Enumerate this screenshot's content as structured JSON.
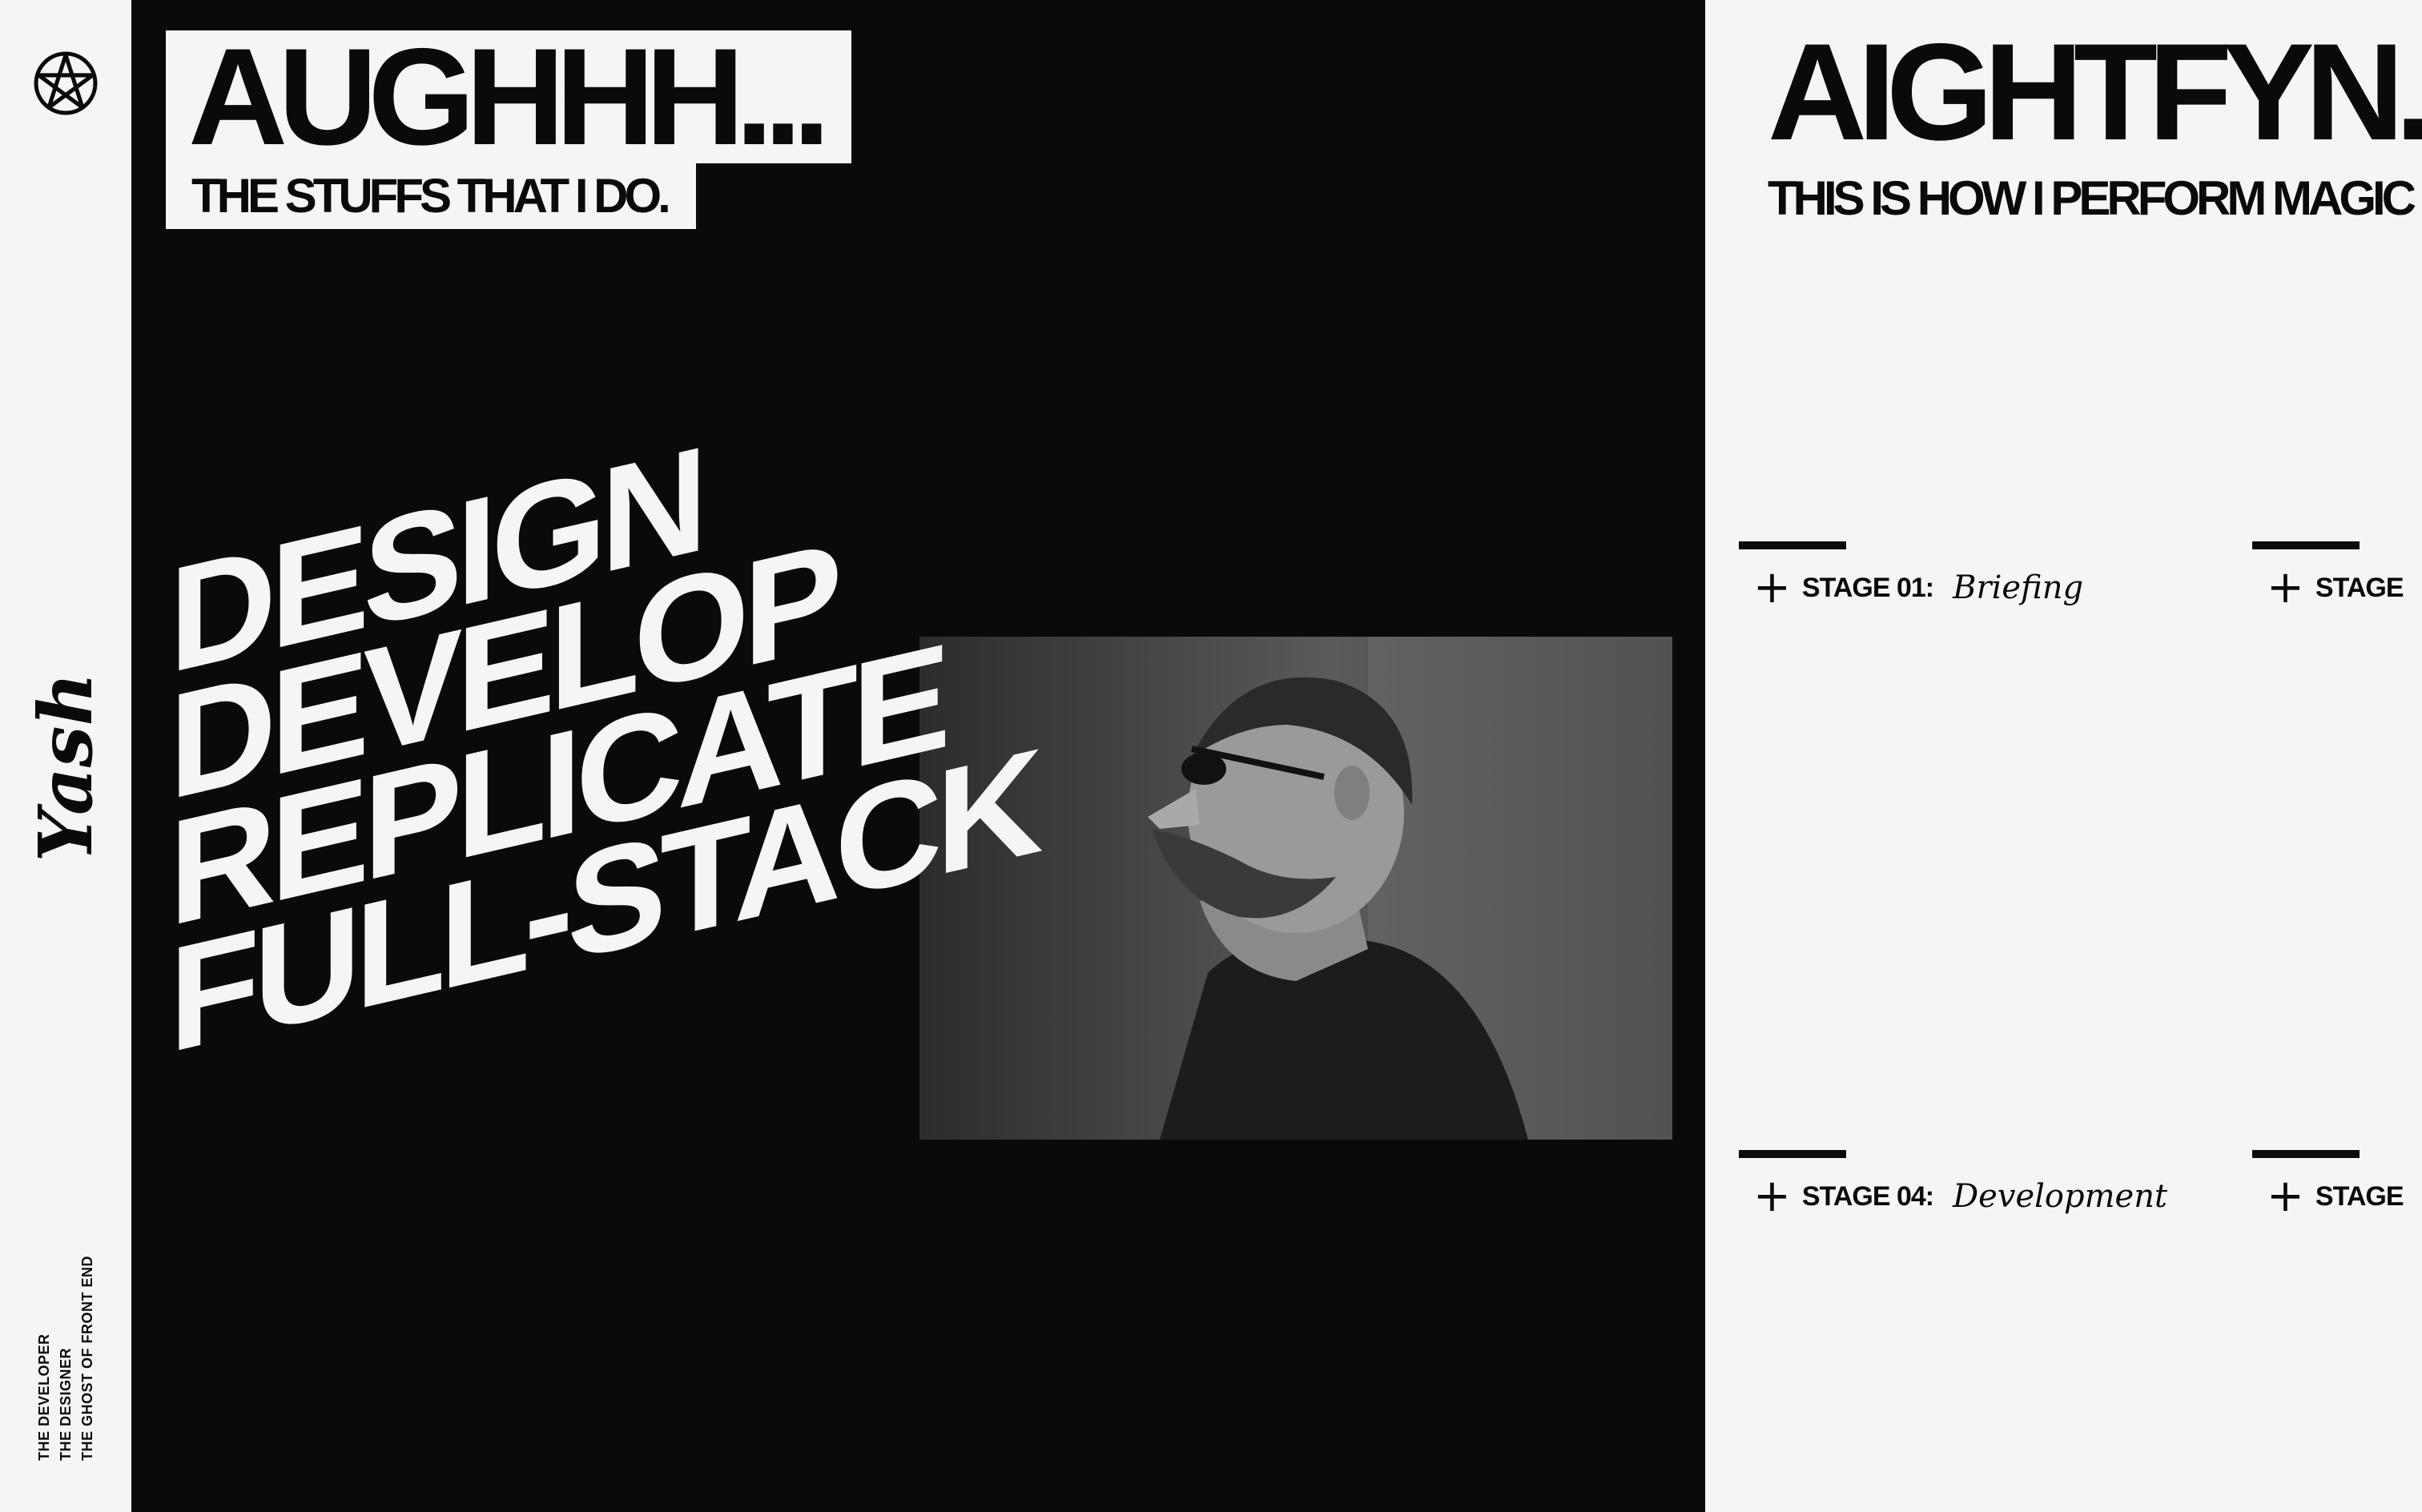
{
  "sidebar": {
    "logo_icon": "pentagram-icon",
    "brand": "Yash",
    "tagline": [
      "THE DEVELOPER",
      "THE DESIGNER",
      "THE GHOST OF FRONT END"
    ]
  },
  "hero": {
    "title": "AUGHHH...",
    "subtitle": "THE STUFFS THAT I DO.",
    "words": [
      "DESIGN",
      "DEVELOP",
      "REPLICATE",
      "FULL-STACK"
    ],
    "photo": "portrait-photo"
  },
  "process": {
    "title": "AIGHTFYN.",
    "subtitle": "THIS IS HOW I PERFORM MAGIC",
    "stages": [
      {
        "label": "STAGE 01:",
        "name": "Briefing"
      },
      {
        "label": "STAGE",
        "name": ""
      },
      {
        "label": "STAGE 04:",
        "name": "Development"
      },
      {
        "label": "STAGE",
        "name": ""
      }
    ]
  },
  "colors": {
    "ink": "#0a0a0c",
    "paper": "#f5f5f5",
    "overlay": "#9a9a9a"
  }
}
